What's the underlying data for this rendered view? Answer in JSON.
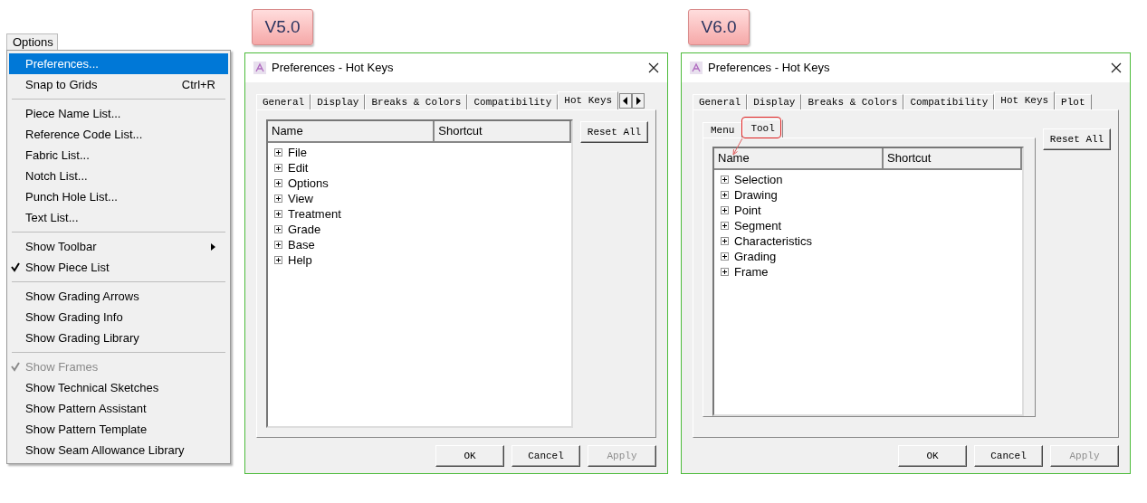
{
  "menu": {
    "title": "Options",
    "items": [
      {
        "kind": "item",
        "label": "Preferences...",
        "selected": true,
        "checked": false,
        "disabled": false,
        "submenu": false
      },
      {
        "kind": "item",
        "label": "Snap to Grids",
        "shortcut": "Ctrl+R",
        "selected": false,
        "checked": false,
        "disabled": false,
        "submenu": false
      },
      {
        "kind": "separator"
      },
      {
        "kind": "item",
        "label": "Piece Name List...",
        "selected": false,
        "checked": false,
        "disabled": false,
        "submenu": false
      },
      {
        "kind": "item",
        "label": "Reference Code List...",
        "selected": false,
        "checked": false,
        "disabled": false,
        "submenu": false
      },
      {
        "kind": "item",
        "label": "Fabric List...",
        "selected": false,
        "checked": false,
        "disabled": false,
        "submenu": false
      },
      {
        "kind": "item",
        "label": "Notch List...",
        "selected": false,
        "checked": false,
        "disabled": false,
        "submenu": false
      },
      {
        "kind": "item",
        "label": "Punch Hole List...",
        "selected": false,
        "checked": false,
        "disabled": false,
        "submenu": false
      },
      {
        "kind": "item",
        "label": "Text List...",
        "selected": false,
        "checked": false,
        "disabled": false,
        "submenu": false
      },
      {
        "kind": "separator"
      },
      {
        "kind": "item",
        "label": "Show Toolbar",
        "selected": false,
        "checked": false,
        "disabled": false,
        "submenu": true
      },
      {
        "kind": "item",
        "label": "Show Piece List",
        "selected": false,
        "checked": true,
        "disabled": false,
        "submenu": false
      },
      {
        "kind": "separator"
      },
      {
        "kind": "item",
        "label": "Show Grading Arrows",
        "selected": false,
        "checked": false,
        "disabled": false,
        "submenu": false
      },
      {
        "kind": "item",
        "label": "Show Grading Info",
        "selected": false,
        "checked": false,
        "disabled": false,
        "submenu": false
      },
      {
        "kind": "item",
        "label": "Show Grading Library",
        "selected": false,
        "checked": false,
        "disabled": false,
        "submenu": false
      },
      {
        "kind": "separator"
      },
      {
        "kind": "item",
        "label": "Show Frames",
        "selected": false,
        "checked": true,
        "disabled": true,
        "submenu": false
      },
      {
        "kind": "item",
        "label": "Show Technical Sketches",
        "selected": false,
        "checked": false,
        "disabled": false,
        "submenu": false
      },
      {
        "kind": "item",
        "label": "Show Pattern Assistant",
        "selected": false,
        "checked": false,
        "disabled": false,
        "submenu": false
      },
      {
        "kind": "item",
        "label": "Show Pattern Template",
        "selected": false,
        "checked": false,
        "disabled": false,
        "submenu": false
      },
      {
        "kind": "item",
        "label": "Show Seam Allowance Library",
        "selected": false,
        "checked": false,
        "disabled": false,
        "submenu": false
      }
    ]
  },
  "dialogs": [
    {
      "version": "V5.0",
      "title": "Preferences - Hot Keys",
      "tab_scroll_arrows": true,
      "tabs": [
        {
          "label": "General",
          "selected": false
        },
        {
          "label": "Display",
          "selected": false
        },
        {
          "label": "Breaks & Colors",
          "selected": false
        },
        {
          "label": "Compatibility",
          "selected": false
        },
        {
          "label": "Hot Keys",
          "selected": true
        }
      ],
      "columns": [
        "Name",
        "Shortcut"
      ],
      "rows": [
        {
          "name": "File",
          "expanded": false
        },
        {
          "name": "Edit",
          "expanded": false
        },
        {
          "name": "Options",
          "expanded": false
        },
        {
          "name": "View",
          "expanded": false
        },
        {
          "name": "Treatment",
          "expanded": false
        },
        {
          "name": "Grade",
          "expanded": false
        },
        {
          "name": "Base",
          "expanded": false
        },
        {
          "name": "Help",
          "expanded": false
        }
      ],
      "side_button": "Reset All",
      "buttons": [
        {
          "label": "OK",
          "disabled": false
        },
        {
          "label": "Cancel",
          "disabled": false
        },
        {
          "label": "Apply",
          "disabled": true
        }
      ]
    },
    {
      "version": "V6.0",
      "title": "Preferences - Hot Keys",
      "tab_scroll_arrows": false,
      "tabs": [
        {
          "label": "General",
          "selected": false
        },
        {
          "label": "Display",
          "selected": false
        },
        {
          "label": "Breaks & Colors",
          "selected": false
        },
        {
          "label": "Compatibility",
          "selected": false
        },
        {
          "label": "Hot Keys",
          "selected": true
        },
        {
          "label": "Plot",
          "selected": false
        }
      ],
      "subtabs": [
        {
          "label": "Menu",
          "selected": false,
          "callout": false
        },
        {
          "label": "Tool",
          "selected": true,
          "callout": true
        }
      ],
      "columns": [
        "Name",
        "Shortcut"
      ],
      "rows": [
        {
          "name": "Selection",
          "expanded": false
        },
        {
          "name": "Drawing",
          "expanded": false
        },
        {
          "name": "Point",
          "expanded": false
        },
        {
          "name": "Segment",
          "expanded": false
        },
        {
          "name": "Characteristics",
          "expanded": false
        },
        {
          "name": "Grading",
          "expanded": false
        },
        {
          "name": "Frame",
          "expanded": false
        }
      ],
      "side_button": "Reset All",
      "buttons": [
        {
          "label": "OK",
          "disabled": false
        },
        {
          "label": "Cancel",
          "disabled": false
        },
        {
          "label": "Apply",
          "disabled": true
        }
      ]
    }
  ]
}
